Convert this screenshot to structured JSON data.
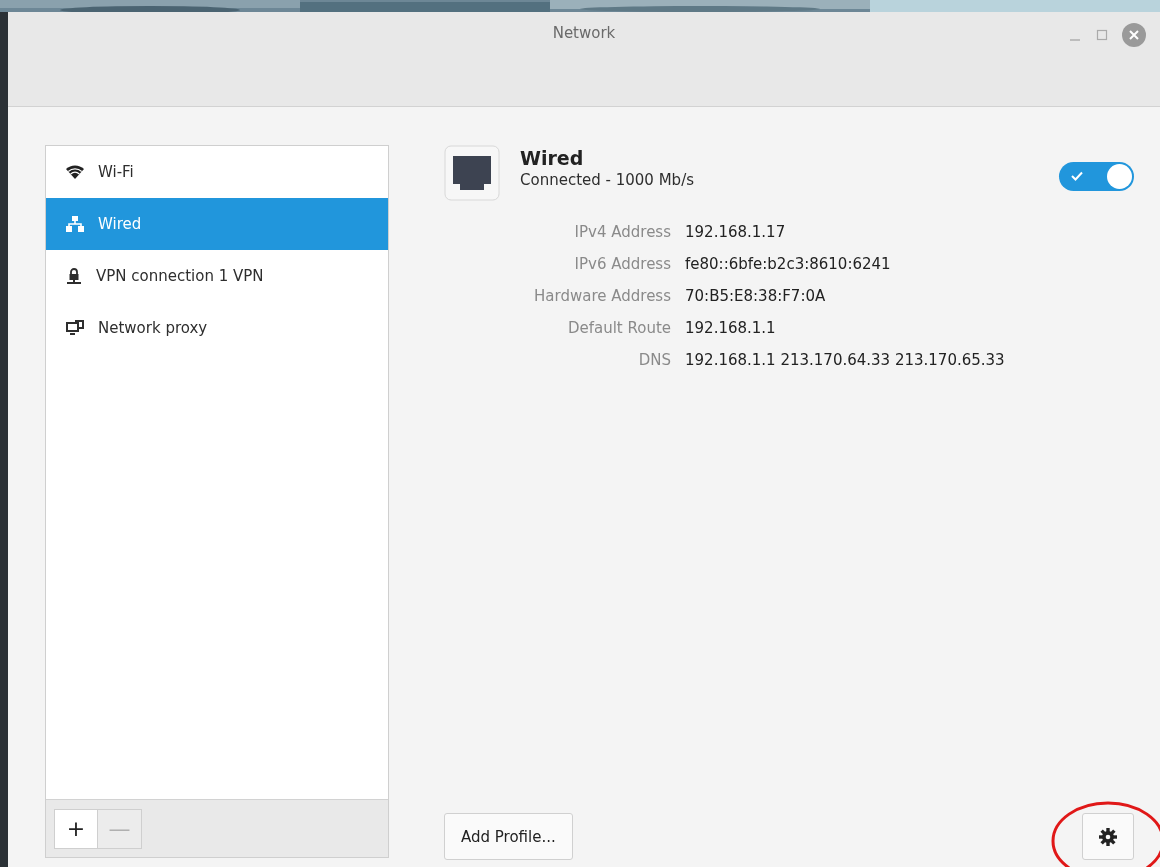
{
  "window": {
    "title": "Network"
  },
  "sidebar": {
    "items": [
      {
        "label": "Wi-Fi",
        "kind": "wifi",
        "selected": false
      },
      {
        "label": "Wired",
        "kind": "wired",
        "selected": true
      },
      {
        "label": "VPN connection 1 VPN",
        "kind": "vpn",
        "selected": false
      },
      {
        "label": "Network proxy",
        "kind": "proxy",
        "selected": false
      }
    ],
    "buttons": [
      {
        "label": "+",
        "disabled": false
      },
      {
        "label": "—",
        "disabled": true
      }
    ]
  },
  "details": {
    "title": "Wired",
    "status": "Connected - 1000 Mb/s",
    "on": true,
    "fields": [
      {
        "label": "IPv4 Address",
        "value": "192.168.1.17"
      },
      {
        "label": "IPv6 Address",
        "value": "fe80::6bfe:b2c3:8610:6241"
      },
      {
        "label": "Hardware Address",
        "value": "70:B5:E8:38:F7:0A"
      },
      {
        "label": "Default Route",
        "value": "192.168.1.1"
      },
      {
        "label": "DNS",
        "value": "192.168.1.1 213.170.64.33 213.170.65.33"
      }
    ],
    "add_profile_button": "Add Profile..."
  },
  "annotation": {
    "kind": "ellipse"
  }
}
